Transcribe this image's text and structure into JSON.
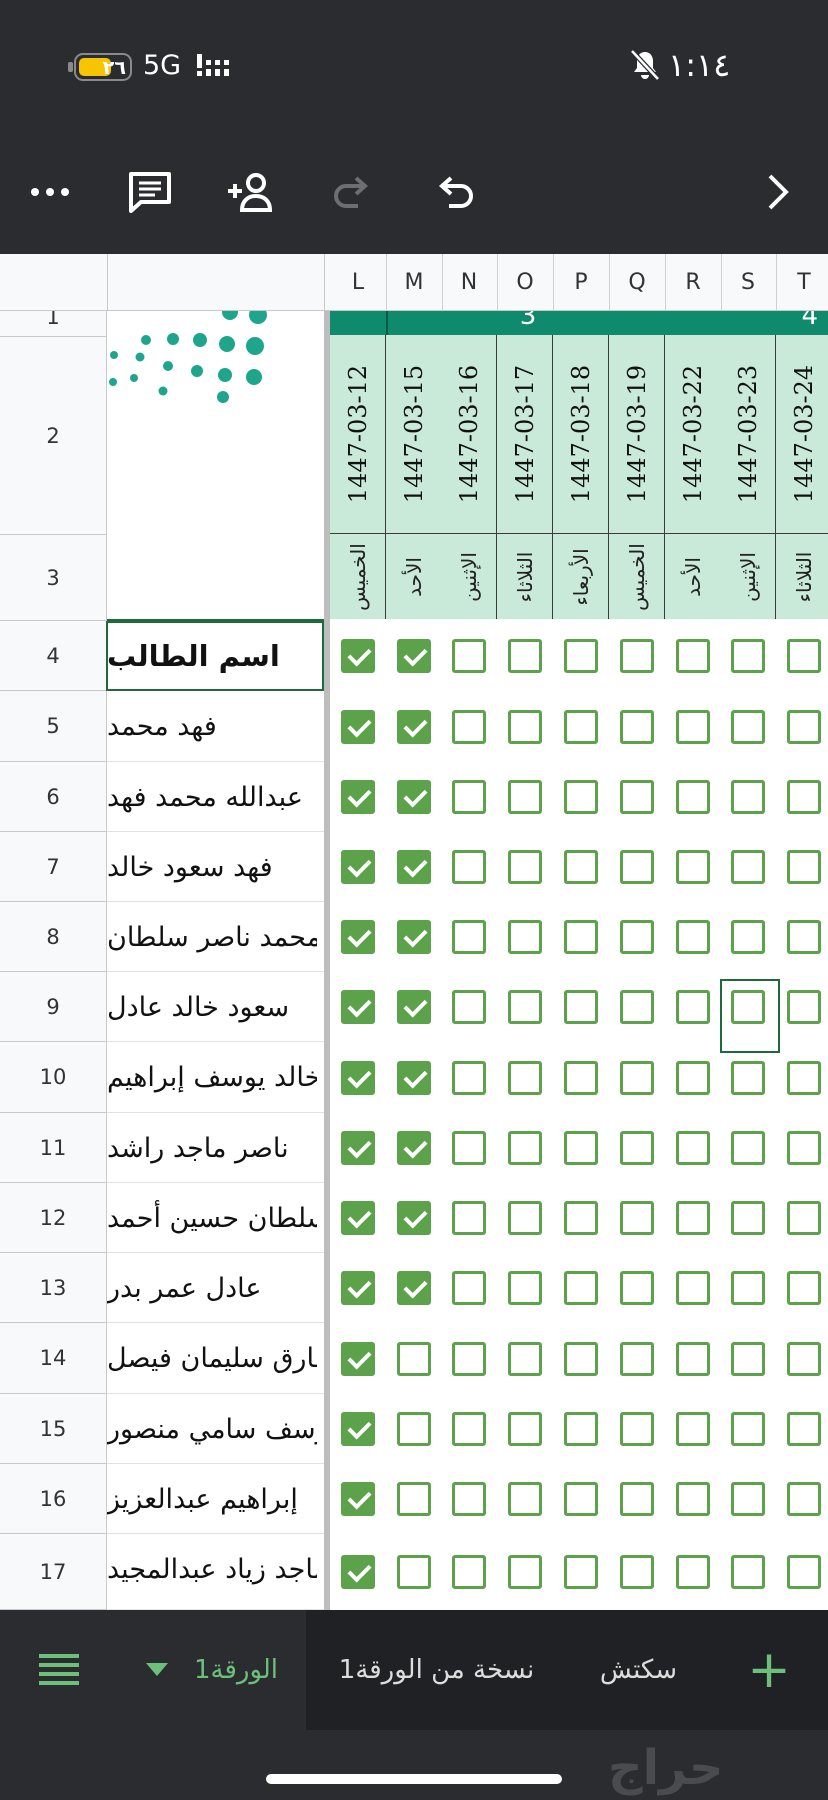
{
  "status_bar": {
    "battery": "٢٦",
    "network": "5G",
    "time": "١:١٤"
  },
  "toolbar": {
    "more": "more-icon",
    "comment": "comment-icon",
    "share": "add-person-icon",
    "redo": "redo-icon",
    "undo": "undo-icon",
    "forward": "chevron-right-icon"
  },
  "columns": [
    "L",
    "M",
    "N",
    "O",
    "P",
    "Q",
    "R",
    "S",
    "T"
  ],
  "week_labels": [
    "3",
    "4"
  ],
  "dates": [
    "1447-03-12",
    "1447-03-15",
    "1447-03-16",
    "1447-03-17",
    "1447-03-18",
    "1447-03-19",
    "1447-03-22",
    "1447-03-23",
    "1447-03-24"
  ],
  "days": [
    "الخميس",
    "الأحد",
    "الإثنين",
    "الثلاثاء",
    "الأربعاء",
    "الخميس",
    "الأحد",
    "الإثنين",
    "الثلاثاء"
  ],
  "row_numbers": [
    "1",
    "2",
    "3",
    "4",
    "5",
    "6",
    "7",
    "8",
    "9",
    "10",
    "11",
    "12",
    "13",
    "14",
    "15",
    "16",
    "17"
  ],
  "header_label": "اسم الطالب",
  "students": [
    {
      "name": "فهد محمد",
      "checked": [
        true,
        true,
        false,
        false,
        false,
        false,
        false,
        false,
        false
      ]
    },
    {
      "name": "عبدالله محمد فهد",
      "checked": [
        true,
        true,
        false,
        false,
        false,
        false,
        false,
        false,
        false
      ]
    },
    {
      "name": "فهد سعود خالد",
      "checked": [
        true,
        true,
        false,
        false,
        false,
        false,
        false,
        false,
        false
      ]
    },
    {
      "name": "محمد ناصر سلطان",
      "checked": [
        true,
        true,
        false,
        false,
        false,
        false,
        false,
        false,
        false
      ]
    },
    {
      "name": "سعود خالد عادل",
      "checked": [
        true,
        true,
        false,
        false,
        false,
        false,
        false,
        false,
        false
      ]
    },
    {
      "name": "خالد يوسف إبراهيم",
      "checked": [
        true,
        true,
        false,
        false,
        false,
        false,
        false,
        false,
        false
      ]
    },
    {
      "name": "ناصر ماجد راشد",
      "checked": [
        true,
        true,
        false,
        false,
        false,
        false,
        false,
        false,
        false
      ]
    },
    {
      "name": "سلطان حسين أحمد",
      "checked": [
        true,
        true,
        false,
        false,
        false,
        false,
        false,
        false,
        false
      ]
    },
    {
      "name": "عادل عمر بدر",
      "checked": [
        true,
        true,
        false,
        false,
        false,
        false,
        false,
        false,
        false
      ]
    },
    {
      "name": "طارق سليمان فيصل",
      "checked": [
        true,
        false,
        false,
        false,
        false,
        false,
        false,
        false,
        false
      ]
    },
    {
      "name": "يوسف سامي منصور",
      "checked": [
        true,
        false,
        false,
        false,
        false,
        false,
        false,
        false,
        false
      ]
    },
    {
      "name": "إبراهيم عبدالعزيز",
      "checked": [
        true,
        false,
        false,
        false,
        false,
        false,
        false,
        false,
        false
      ]
    },
    {
      "name": "ماجد زياد عبدالمجيد",
      "checked": [
        true,
        false,
        false,
        false,
        false,
        false,
        false,
        false,
        false
      ]
    }
  ],
  "header_row_checked": [
    true,
    true,
    false,
    false,
    false,
    false,
    false,
    false,
    false
  ],
  "tabs": {
    "menu": "menu-icon",
    "sheet1": "الورقة1",
    "copy": "نسخة من الورقة1",
    "sketch": "سكتش",
    "add": "+"
  },
  "watermark": "حراج",
  "colors": {
    "accent": "#5ba24a",
    "band": "#0f8a6c",
    "date_bg": "#c9ead8",
    "chrome": "#2b2c30"
  }
}
